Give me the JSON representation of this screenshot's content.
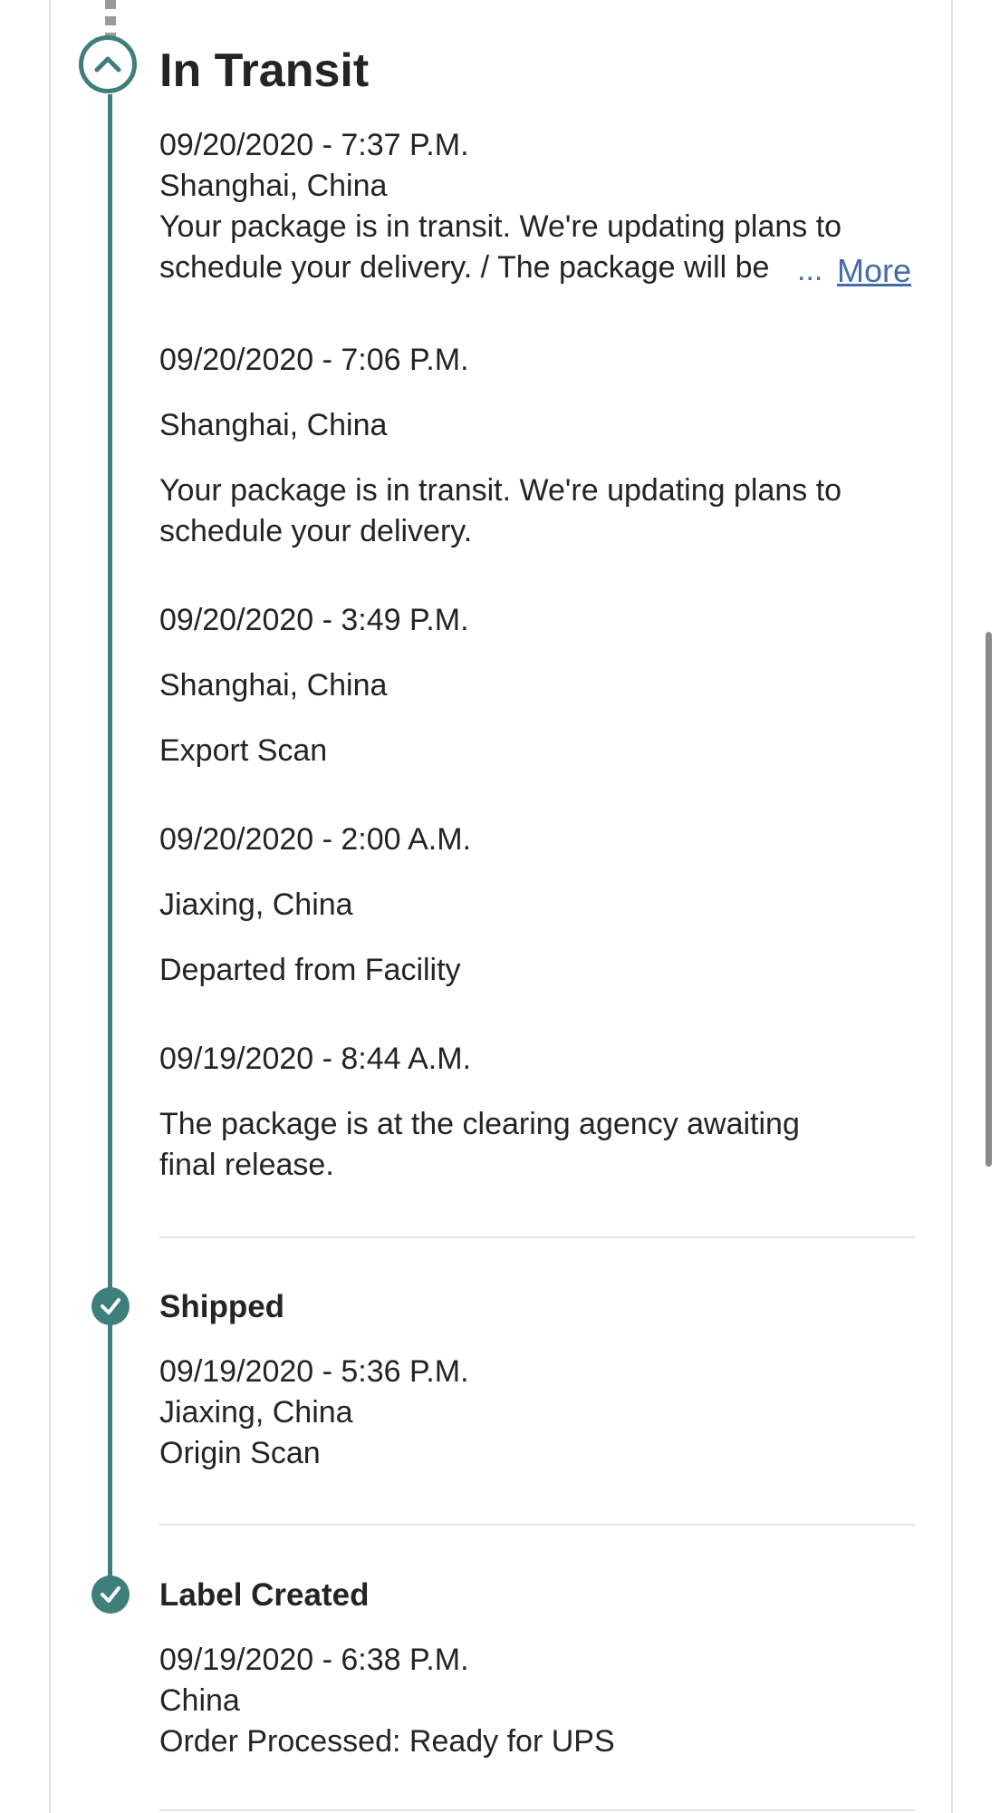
{
  "colors": {
    "accent": "#3f7f7b",
    "link": "#426da9",
    "text": "#242424",
    "divider": "#e4e4e4"
  },
  "in_transit": {
    "title": "In Transit",
    "icon": "chevron-up-icon",
    "events": [
      {
        "datetime": "09/20/2020 - 7:37 P.M.",
        "location": "Shanghai, China",
        "desc_line1": "Your package is in transit. We're updating plans to",
        "desc_line2": "schedule your delivery. / The package will be",
        "ellipsis": "...",
        "more_label": "More"
      },
      {
        "datetime": "09/20/2020 - 7:06 P.M.",
        "location": "Shanghai, China",
        "desc_line1": "Your package is in transit. We're updating plans to",
        "desc_line2": "schedule your delivery."
      },
      {
        "datetime": "09/20/2020 - 3:49 P.M.",
        "location": "Shanghai, China",
        "desc_line1": "Export Scan"
      },
      {
        "datetime": "09/20/2020 - 2:00 A.M.",
        "location": "Jiaxing, China",
        "desc_line1": "Departed from Facility"
      },
      {
        "datetime": "09/19/2020 - 8:44 A.M.",
        "desc_line1": "The package is at the clearing agency awaiting",
        "desc_line2": "final release."
      }
    ]
  },
  "shipped": {
    "title": "Shipped",
    "icon": "check-icon",
    "datetime": "09/19/2020 - 5:36 P.M.",
    "location": "Jiaxing, China",
    "desc": "Origin Scan"
  },
  "label_created": {
    "title": "Label Created",
    "icon": "check-icon",
    "datetime": "09/19/2020 - 6:38 P.M.",
    "location": "China",
    "desc": "Order Processed: Ready for UPS"
  }
}
